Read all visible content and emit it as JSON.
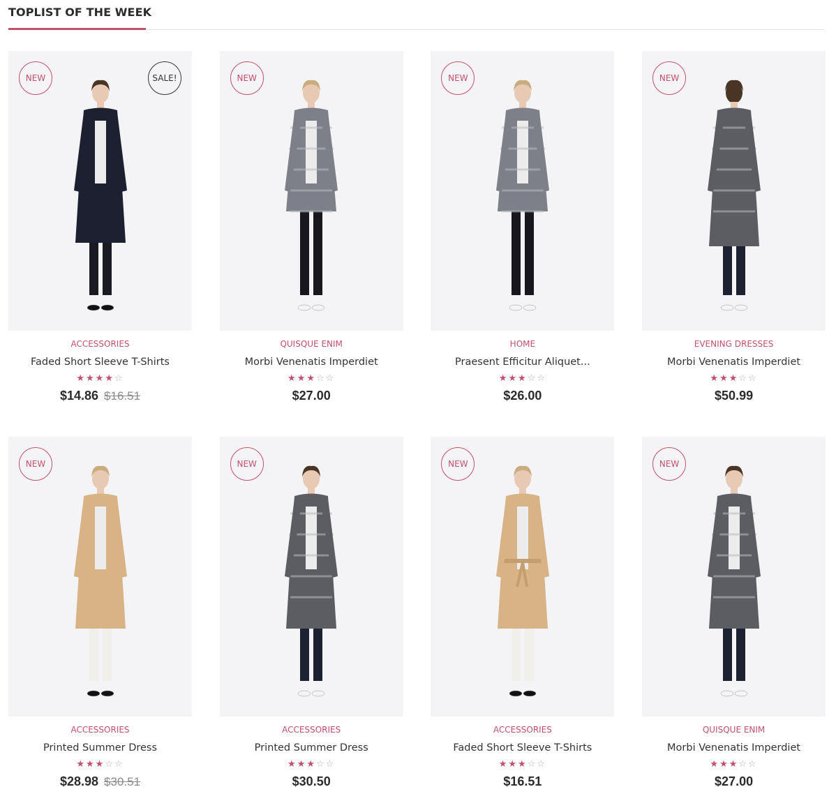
{
  "section": {
    "title": "TOPLIST OF THE WEEK"
  },
  "colors": {
    "accent": "#c24f6c",
    "image_bg": "#f4f4f6",
    "text": "#333333"
  },
  "products": [
    {
      "badge_new": "NEW",
      "badge_sale": "SALE!",
      "category": "ACCESSORIES",
      "name": "Faded Short Sleeve T-Shirts",
      "rating": 4,
      "price": "$14.86",
      "old_price": "$16.51",
      "coat": "black",
      "style": "front"
    },
    {
      "badge_new": "NEW",
      "category": "QUISQUE ENIM",
      "name": "Morbi Venenatis Imperdiet",
      "rating": 3,
      "price": "$27.00",
      "coat": "pattern",
      "style": "front"
    },
    {
      "badge_new": "NEW",
      "category": "HOME",
      "name": "Praesent Efficitur Aliquet...",
      "rating": 3,
      "price": "$26.00",
      "coat": "pattern",
      "style": "front"
    },
    {
      "badge_new": "NEW",
      "category": "EVENING DRESSES",
      "name": "Morbi Venenatis Imperdiet",
      "rating": 3,
      "price": "$50.99",
      "coat": "grey",
      "style": "back"
    },
    {
      "badge_new": "NEW",
      "category": "ACCESSORIES",
      "name": "Printed Summer Dress",
      "rating": 3,
      "price": "$28.98",
      "old_price": "$30.51",
      "coat": "camel",
      "style": "front"
    },
    {
      "badge_new": "NEW",
      "category": "ACCESSORIES",
      "name": "Printed Summer Dress",
      "rating": 3,
      "price": "$30.50",
      "coat": "grey",
      "style": "side"
    },
    {
      "badge_new": "NEW",
      "category": "ACCESSORIES",
      "name": "Faded Short Sleeve T-Shirts",
      "rating": 3,
      "price": "$16.51",
      "coat": "camel",
      "style": "belt"
    },
    {
      "badge_new": "NEW",
      "category": "QUISQUE ENIM",
      "name": "Morbi Venenatis Imperdiet",
      "rating": 3,
      "price": "$27.00",
      "coat": "grey",
      "style": "side"
    }
  ]
}
